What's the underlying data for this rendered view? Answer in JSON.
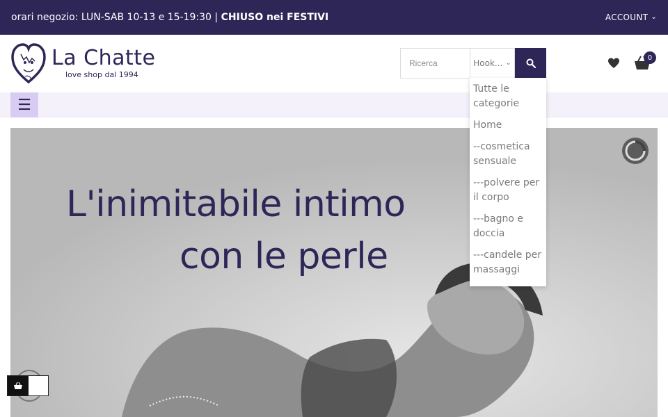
{
  "topbar": {
    "hours_prefix": "orari negozio: LUN-SAB 10-13 e 15-19:30 | ",
    "hours_bold": "CHIUSO nei FESTIVI",
    "account_label": "ACCOUNT"
  },
  "logo": {
    "title": "La Chatte",
    "subtitle": "love shop dal 1994"
  },
  "search": {
    "placeholder": "Ricerca",
    "category_selected": "Hook..."
  },
  "cart": {
    "count": "0"
  },
  "category_dropdown": {
    "options": [
      "Tutte le categorie",
      "Home",
      "--cosmetica sensuale",
      "---polvere per il corpo",
      "---bagno e doccia",
      "---candele per massaggi"
    ]
  },
  "hero": {
    "line1": "L'inimitabile intimo",
    "line2": "con le perle"
  },
  "icons": {
    "menu": "hamburger-icon",
    "search": "search-icon",
    "wishlist": "heart-icon",
    "cart": "basket-icon",
    "slider_loader": "loading-spinner-icon"
  },
  "colors": {
    "brand": "#2f2658",
    "menu_button": "#d9ccf3",
    "nav_bg": "#f4f1fb"
  }
}
